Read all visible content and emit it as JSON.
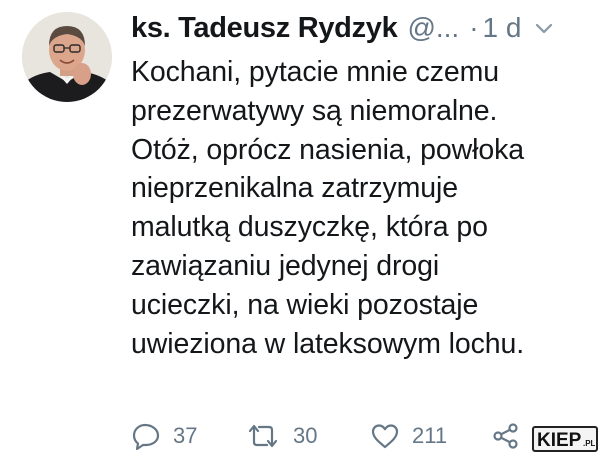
{
  "tweet": {
    "author_name": "ks. Tadeusz Rydzyk",
    "handle": "@...",
    "dot": "·",
    "time": "1 d",
    "text": "Kochani, pytacie mnie czemu\nprezerwatywy są niemoralne.\nOtóż, oprócz nasienia, powłoka\nnieprzenikalna zatrzymuje\nmalutką duszyczkę, która po\nzawiązaniu jedynej drogi\nucieczki, na wieki pozostaje\nuwieziona w lateksowym lochu.",
    "actions": {
      "reply_count": "37",
      "retweet_count": "30",
      "like_count": "211"
    }
  },
  "icons": {
    "reply": "reply-icon",
    "retweet": "retweet-icon",
    "like": "heart-icon",
    "share": "share-icon",
    "more": "chevron-down-icon"
  },
  "watermark": {
    "text": "KIEP.PL"
  },
  "colors": {
    "text": "#14171a",
    "secondary": "#657786",
    "background": "#ffffff"
  }
}
